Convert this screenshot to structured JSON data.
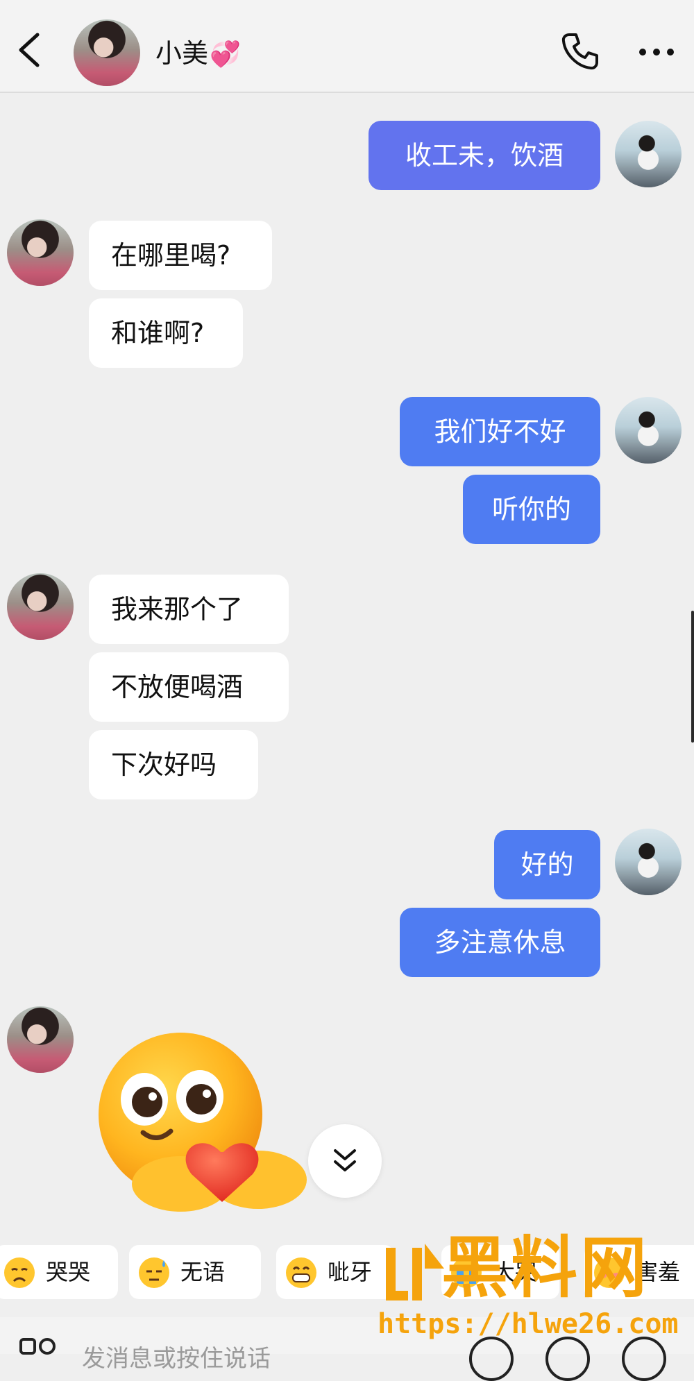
{
  "header": {
    "contact_name": "小美",
    "name_emoji": "💞",
    "icons": [
      "back-arrow-icon",
      "phone-icon",
      "more-icon"
    ]
  },
  "messages": [
    {
      "side": "out",
      "text": "收工未，饮酒"
    },
    {
      "side": "in",
      "text": "在哪里喝?"
    },
    {
      "side": "in",
      "text": "和谁啊?"
    },
    {
      "side": "out",
      "text": "我们好不好"
    },
    {
      "side": "out",
      "text": "听你的"
    },
    {
      "side": "in",
      "text": "我来那个了"
    },
    {
      "side": "in",
      "text": "不放便喝酒"
    },
    {
      "side": "in",
      "text": "下次好吗"
    },
    {
      "side": "out",
      "text": "好的"
    },
    {
      "side": "out",
      "text": "多注意休息"
    },
    {
      "side": "in",
      "sticker": "smiley-holding-heart"
    }
  ],
  "quick_replies": [
    {
      "label": "哭哭",
      "emoji": "crying-face-icon"
    },
    {
      "label": "无语",
      "emoji": "sweat-face-icon"
    },
    {
      "label": "呲牙",
      "emoji": "grin-face-icon"
    },
    {
      "label": "大哭",
      "emoji": "loud-cry-face-icon"
    },
    {
      "label": "害羞",
      "emoji": "shy-face-icon"
    }
  ],
  "input": {
    "placeholder": "发消息或按住说话"
  },
  "watermark": {
    "title": "黑料网",
    "url": "https://hlwe26.com"
  },
  "colors": {
    "outgoing_bubble": "#4f7cf2",
    "outgoing_bubble_first": "#6273ee",
    "incoming_bubble": "#ffffff",
    "background": "#efefef",
    "watermark": "#f5a30c"
  }
}
